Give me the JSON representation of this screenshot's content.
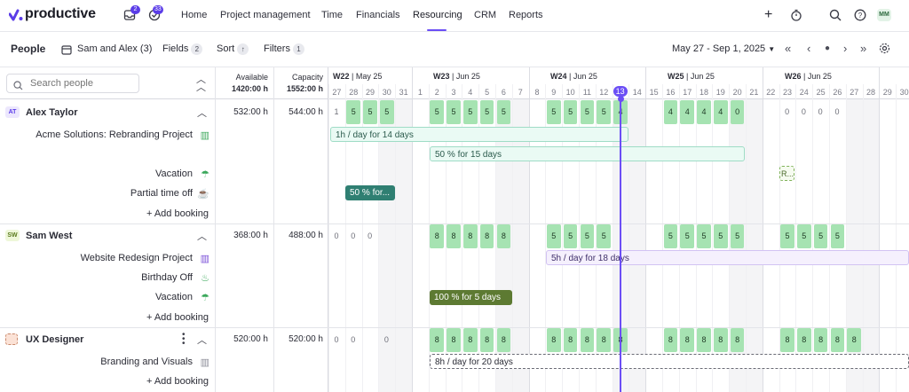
{
  "app": {
    "logo_text": "productive"
  },
  "nav": {
    "items": [
      "Home",
      "Project management",
      "Time",
      "Financials",
      "Resourcing",
      "CRM",
      "Reports"
    ],
    "active": "Resourcing",
    "inbox_badge": "2",
    "tasks_badge": "33",
    "user_initials": "MM"
  },
  "toolbar": {
    "title": "People",
    "view_name": "Sam and Alex (3)",
    "fields_label": "Fields",
    "fields_count": "2",
    "sort_label": "Sort",
    "filters_label": "Filters",
    "filters_count": "1",
    "date_range": "May 27 - Sep 1, 2025"
  },
  "search": {
    "placeholder": "Search people"
  },
  "columns": {
    "available_label": "Available",
    "available_total": "1420:00 h",
    "capacity_label": "Capacity",
    "capacity_total": "1552:00 h"
  },
  "weeks": [
    {
      "week": "W22",
      "month": "May 25"
    },
    {
      "week": "W23",
      "month": "Jun 25"
    },
    {
      "week": "W24",
      "month": "Jun 25"
    },
    {
      "week": "W25",
      "month": "Jun 25"
    },
    {
      "week": "W26",
      "month": "Jun 25"
    }
  ],
  "days": [
    "27",
    "28",
    "29",
    "30",
    "31",
    "1",
    "2",
    "3",
    "4",
    "5",
    "6",
    "7",
    "8",
    "9",
    "10",
    "11",
    "12",
    "13",
    "14",
    "15",
    "16",
    "17",
    "18",
    "19",
    "20",
    "21",
    "22",
    "23",
    "24",
    "25",
    "26",
    "27",
    "28",
    "29",
    "30"
  ],
  "today": "13",
  "people": [
    {
      "initials": "AT",
      "name": "Alex Taylor",
      "available": "532:00 h",
      "capacity": "544:00 h",
      "rows": [
        {
          "label": "Acme Solutions: Rebranding Project",
          "icon": "project-icon"
        },
        {
          "label": "",
          "icon": ""
        },
        {
          "label": "Vacation",
          "icon": "umbrella-icon"
        },
        {
          "label": "Partial time off",
          "icon": "coffee-icon"
        }
      ],
      "add_booking": "+ Add booking",
      "bookings": [
        {
          "text": "1h / day for 14 days"
        },
        {
          "text": "50 % for 15 days"
        },
        {
          "text": "50 % for..."
        },
        {
          "text": "R..."
        }
      ],
      "daily": [
        "1",
        "5",
        "5",
        "5",
        "5",
        "5",
        "5",
        "5",
        "5",
        "5",
        "5",
        "5",
        "5",
        "4",
        "4",
        "4",
        "4",
        "4",
        "0",
        "0",
        "0",
        "0",
        "0"
      ]
    },
    {
      "initials": "SW",
      "name": "Sam West",
      "available": "368:00 h",
      "capacity": "488:00 h",
      "rows": [
        {
          "label": "Website Redesign Project",
          "icon": "project-icon"
        },
        {
          "label": "Birthday Off",
          "icon": "cake-icon"
        },
        {
          "label": "Vacation",
          "icon": "umbrella-icon"
        }
      ],
      "add_booking": "+ Add booking",
      "bookings": [
        {
          "text": "5h / day for 18 days"
        },
        {
          "text": "100 % for 5 days"
        }
      ],
      "daily": [
        "0",
        "0",
        "0",
        "8",
        "8",
        "8",
        "8",
        "8",
        "5",
        "5",
        "5",
        "5",
        "5",
        "5",
        "5",
        "5",
        "5",
        "5",
        "5",
        "5",
        "5"
      ]
    },
    {
      "initials": "",
      "name": "UX Designer",
      "available": "520:00 h",
      "capacity": "520:00 h",
      "rows": [
        {
          "label": "Branding and Visuals",
          "icon": "project-icon"
        }
      ],
      "add_booking": "+ Add booking",
      "bookings": [
        {
          "text": "8h / day for 20 days"
        }
      ],
      "daily": [
        "0",
        "0",
        "0",
        "8",
        "8",
        "8",
        "8",
        "8",
        "8",
        "8",
        "8",
        "8",
        "8",
        "8",
        "8",
        "8",
        "8",
        "8",
        "8",
        "8",
        "8",
        "8",
        "8"
      ]
    }
  ],
  "colors": {
    "accent": "#6b4ef5",
    "green_cell": "#a6e3b2",
    "teal_booking": "#2f7f72",
    "olive_booking": "#5d7a32"
  }
}
